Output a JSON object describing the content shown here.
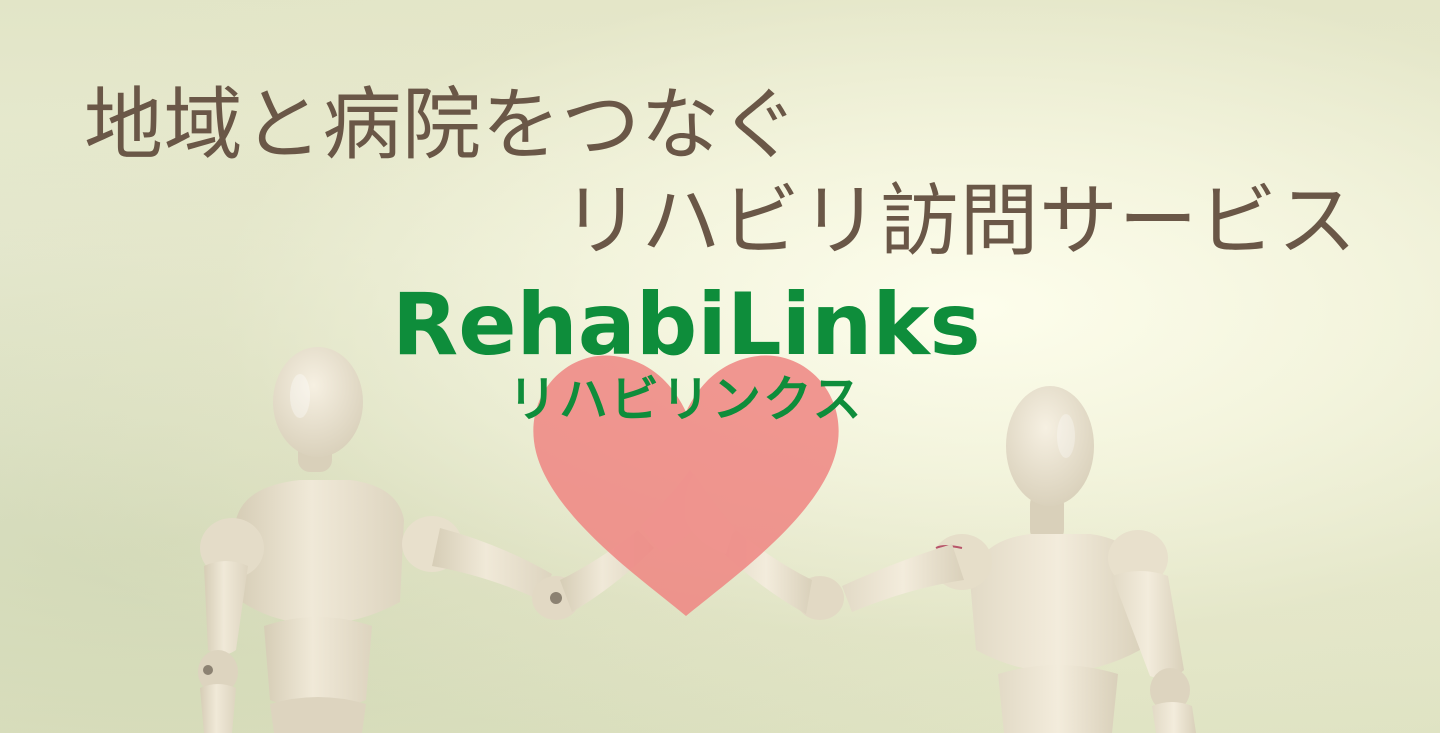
{
  "headline": {
    "line1": "地域と病院をつなぐ",
    "line2": "リハビリ訪問サービス"
  },
  "brand": {
    "name": "RehabiLinks",
    "kana": "リハビリンクス"
  },
  "colors": {
    "headline_text": "#6a5747",
    "brand_green": "#0e8d3b",
    "heart": "#ef8682",
    "background": "#e6e9cd",
    "figure": "#ebe3cf"
  },
  "icons": {
    "heart": "heart-icon"
  }
}
